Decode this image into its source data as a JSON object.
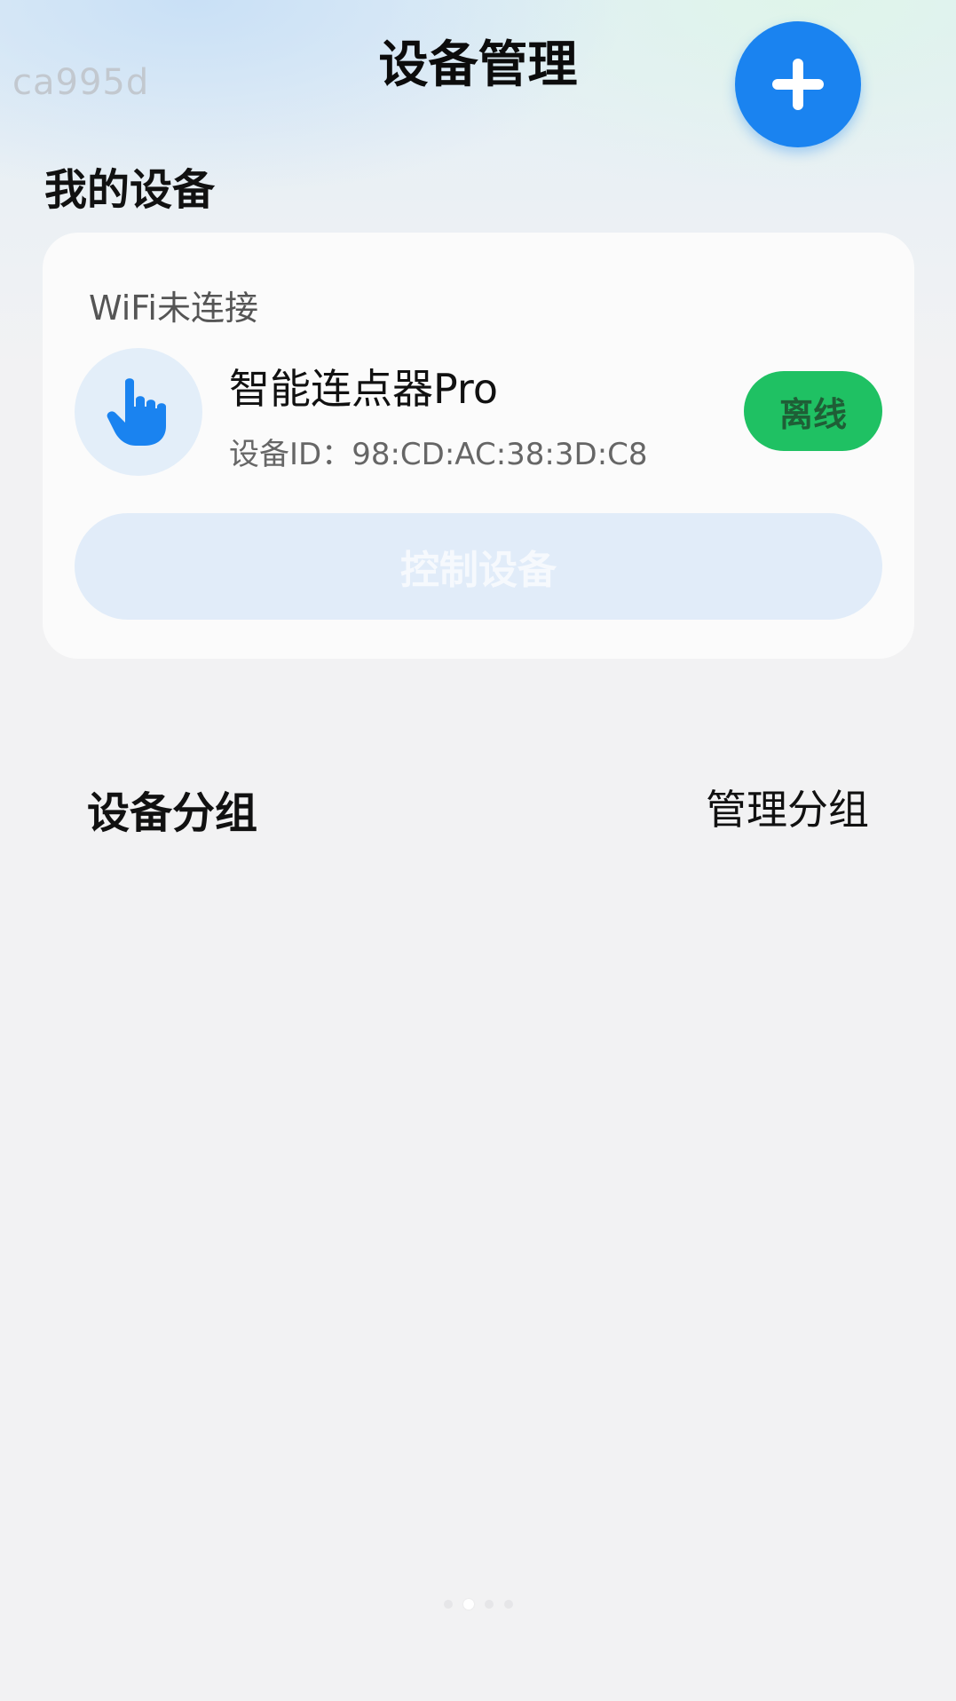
{
  "watermark": "ca995d",
  "header": {
    "title": "设备管理",
    "add_icon": "plus-icon"
  },
  "my_devices": {
    "title": "我的设备",
    "card": {
      "wifi_status": "WiFi未连接",
      "device_icon": "tap-hand-icon",
      "device_name": "智能连点器Pro",
      "device_id": "设备ID：98:CD:AC:38:3D:C8",
      "status_badge": "离线",
      "control_label": "控制设备"
    }
  },
  "device_groups": {
    "title": "设备分组",
    "manage_label": "管理分组"
  },
  "pager": {
    "count": 4,
    "active_index": 1
  },
  "colors": {
    "accent": "#1a83f0",
    "status_green": "#1fc163",
    "disabled_button": "#e1ecf9",
    "page_background": "#f2f2f3"
  }
}
